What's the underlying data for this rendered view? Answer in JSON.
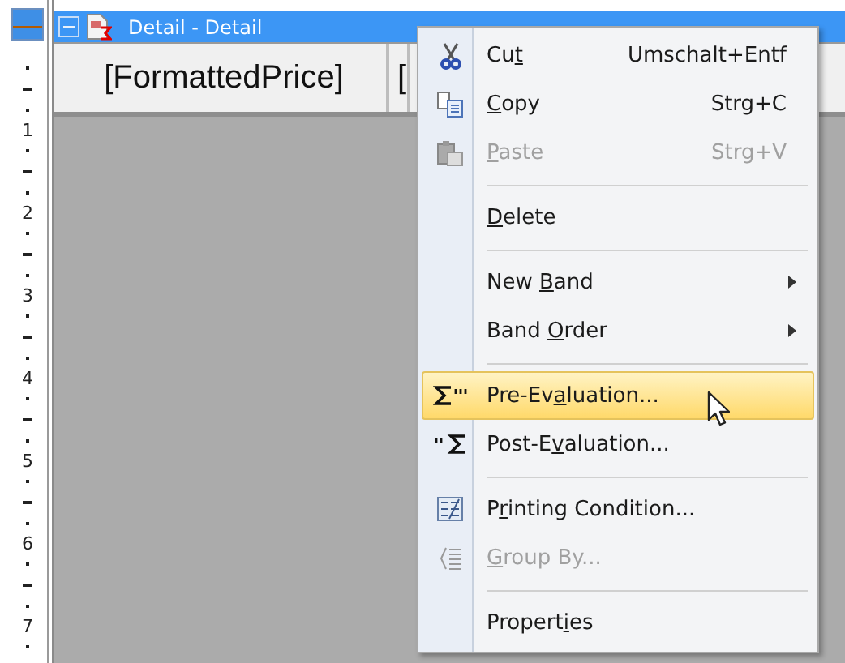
{
  "ruler": {
    "numbers": [
      "1",
      "2",
      "3",
      "4",
      "5",
      "6",
      "7"
    ]
  },
  "band": {
    "title": "Detail - Detail",
    "expanded": true
  },
  "fields": [
    "[FormattedPrice]",
    "["
  ],
  "context_menu": {
    "items": [
      {
        "kind": "item",
        "label": {
          "before": "Cu",
          "key": "t"
        },
        "shortcut": "Umschalt+Entf",
        "disabled": false,
        "selected": false,
        "has_submenu": false
      },
      {
        "kind": "item",
        "label": {
          "key": "C",
          "after": "opy"
        },
        "shortcut": "Strg+C",
        "disabled": false,
        "selected": false,
        "has_submenu": false
      },
      {
        "kind": "item",
        "label": {
          "key": "P",
          "after": "aste"
        },
        "shortcut": "Strg+V",
        "disabled": true,
        "selected": false,
        "has_submenu": false
      },
      {
        "kind": "separator"
      },
      {
        "kind": "item",
        "label": {
          "key": "D",
          "after": "elete"
        },
        "disabled": false,
        "selected": false,
        "has_submenu": false
      },
      {
        "kind": "separator"
      },
      {
        "kind": "item",
        "label": {
          "before": "New ",
          "key": "B",
          "after": "and"
        },
        "disabled": false,
        "selected": false,
        "has_submenu": true
      },
      {
        "kind": "item",
        "label": {
          "before": "Band ",
          "key": "O",
          "after": "rder"
        },
        "disabled": false,
        "selected": false,
        "has_submenu": true
      },
      {
        "kind": "separator"
      },
      {
        "kind": "item",
        "label": {
          "before": "Pre-Ev",
          "key": "a",
          "after": "luation..."
        },
        "disabled": false,
        "selected": true,
        "has_submenu": false
      },
      {
        "kind": "item",
        "label": {
          "before": "Post-E",
          "key": "v",
          "after": "aluation..."
        },
        "disabled": false,
        "selected": false,
        "has_submenu": false
      },
      {
        "kind": "separator"
      },
      {
        "kind": "item",
        "label": {
          "before": "P",
          "key": "r",
          "after": "inting Condition..."
        },
        "disabled": false,
        "selected": false,
        "has_submenu": false
      },
      {
        "kind": "item",
        "label": {
          "key": "G",
          "after": "roup By..."
        },
        "disabled": true,
        "selected": false,
        "has_submenu": false
      },
      {
        "kind": "separator"
      },
      {
        "kind": "item",
        "label": {
          "before": "Propert",
          "key": "i",
          "after": "es"
        },
        "disabled": false,
        "selected": false,
        "has_submenu": false
      }
    ]
  }
}
